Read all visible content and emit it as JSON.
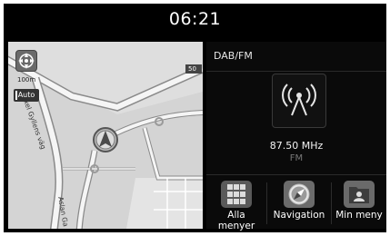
{
  "status": {
    "time": "06:21"
  },
  "map": {
    "scale_label": "100m",
    "view_mode_label": "Auto",
    "road_badge": "50",
    "street_labels": [
      "Axel Gyllens väg"
    ],
    "lower_street_label": "Aslan Ga"
  },
  "media": {
    "source": "DAB/FM",
    "frequency": "87.50 MHz",
    "band": "FM"
  },
  "launcher": {
    "all_menus": "Alla menyer",
    "navigation": "Navigation",
    "my_menu": "Min meny"
  },
  "colors": {
    "map_bg": "#d9d9d9",
    "road": "#f5f5f5",
    "road_edge": "#8a8a8a",
    "accent": "#6b6b6b"
  }
}
